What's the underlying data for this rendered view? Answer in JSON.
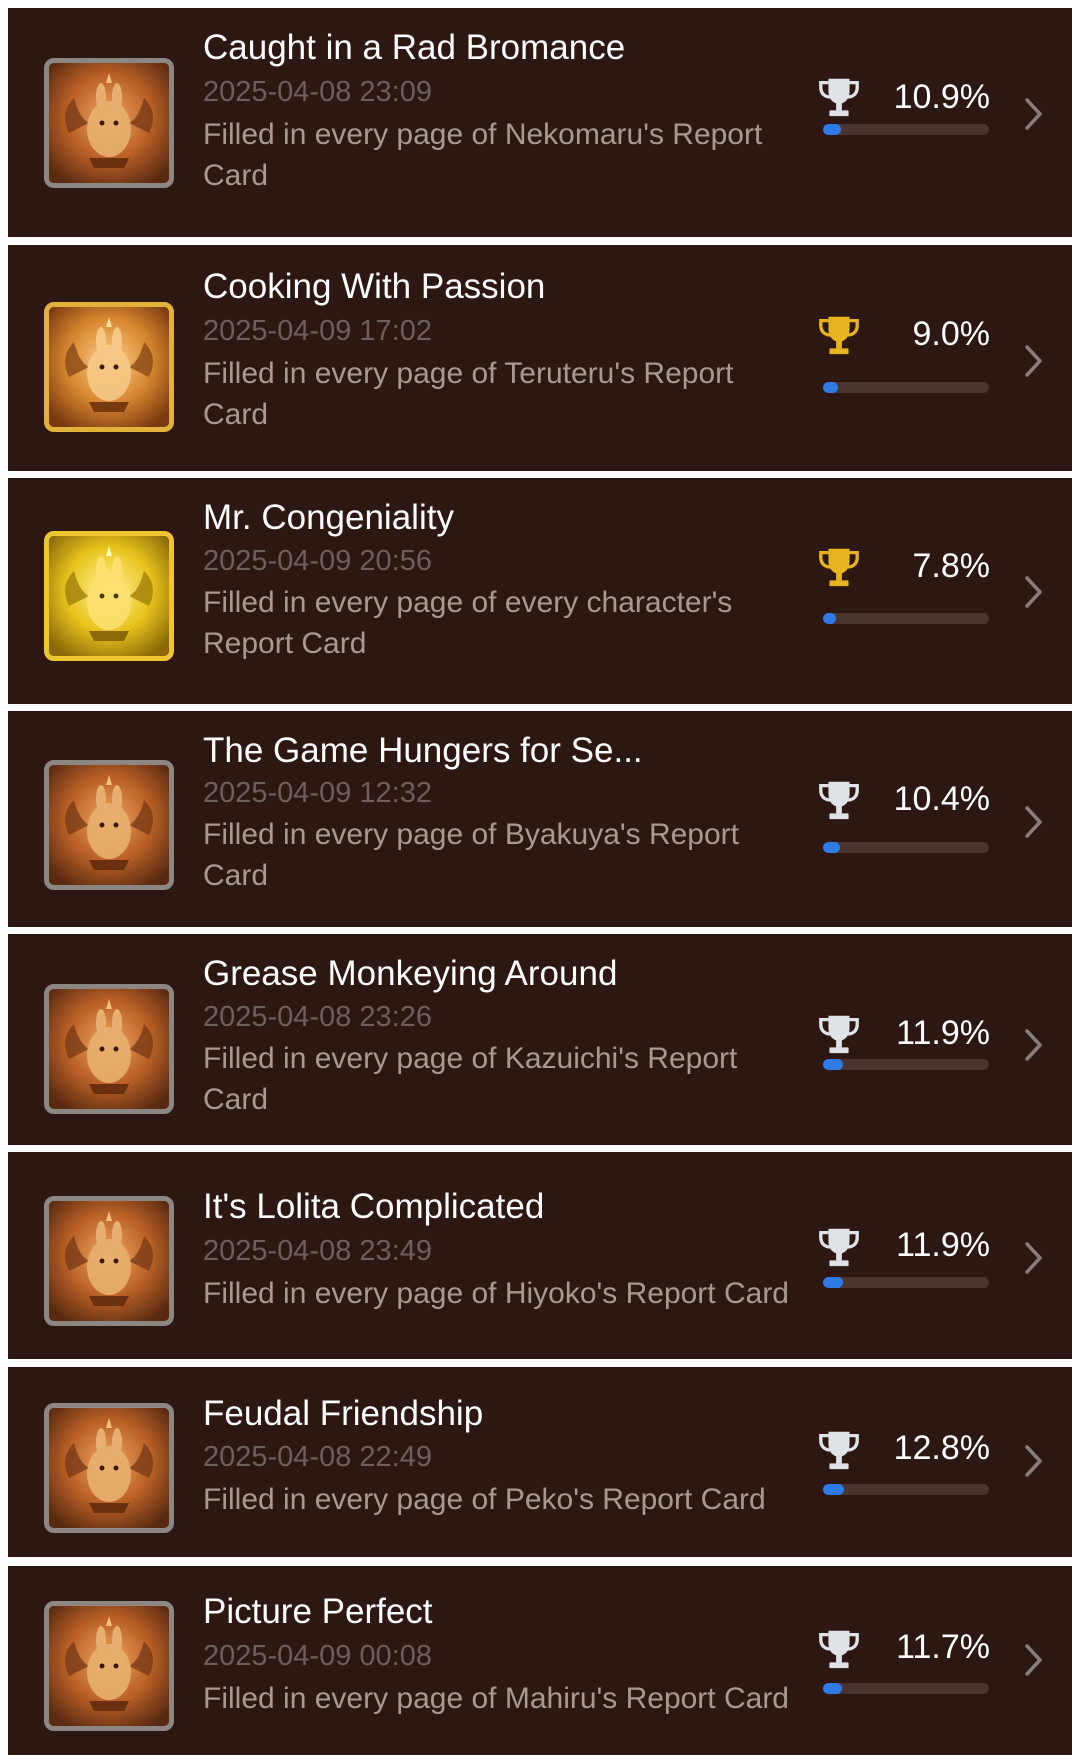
{
  "colors": {
    "card_bg": "#2c1712",
    "title": "#ffffff",
    "date": "#6d5f5b",
    "description": "#a89a93",
    "progress_fill": "#2f7be6",
    "progress_track": "#4a3430",
    "trophy_silver": "#dfe2e6",
    "trophy_gold": "#e9b21f"
  },
  "achievements": [
    {
      "title": "Caught in a Rad Bromance",
      "date": "2025-04-08 23:09",
      "description": "Filled in every page of Nekomaru's Report Card",
      "percent": "10.9%",
      "progress": 0.109,
      "trophy_icon": "trophy-silver-icon",
      "badge_tier": "bronze"
    },
    {
      "title": "Cooking With Passion",
      "date": "2025-04-09 17:02",
      "description": "Filled in every page of Teruteru's Report Card",
      "percent": "9.0%",
      "progress": 0.09,
      "trophy_icon": "trophy-gold-icon",
      "badge_tier": "gold"
    },
    {
      "title": "Mr. Congeniality",
      "date": "2025-04-09 20:56",
      "description": "Filled in every page of every character's Report Card",
      "percent": "7.8%",
      "progress": 0.078,
      "trophy_icon": "trophy-gold-icon",
      "badge_tier": "bright-gold"
    },
    {
      "title": "The Game Hungers for Se...",
      "date": "2025-04-09 12:32",
      "description": "Filled in every page of Byakuya's Report Card",
      "percent": "10.4%",
      "progress": 0.104,
      "trophy_icon": "trophy-silver-icon",
      "badge_tier": "bronze"
    },
    {
      "title": "Grease Monkeying Around",
      "date": "2025-04-08 23:26",
      "description": "Filled in every page of Kazuichi's Report Card",
      "percent": "11.9%",
      "progress": 0.119,
      "trophy_icon": "trophy-silver-icon",
      "badge_tier": "bronze"
    },
    {
      "title": "It's Lolita Complicated",
      "date": "2025-04-08 23:49",
      "description": "Filled in every page of Hiyoko's Report Card",
      "percent": "11.9%",
      "progress": 0.119,
      "trophy_icon": "trophy-silver-icon",
      "badge_tier": "bronze"
    },
    {
      "title": "Feudal Friendship",
      "date": "2025-04-08 22:49",
      "description": "Filled in every page of Peko's Report Card",
      "percent": "12.8%",
      "progress": 0.128,
      "trophy_icon": "trophy-silver-icon",
      "badge_tier": "bronze"
    },
    {
      "title": "Picture Perfect",
      "date": "2025-04-09 00:08",
      "description": "Filled in every page of Mahiru's Report Card",
      "percent": "11.7%",
      "progress": 0.117,
      "trophy_icon": "trophy-silver-icon",
      "badge_tier": "bronze"
    }
  ]
}
